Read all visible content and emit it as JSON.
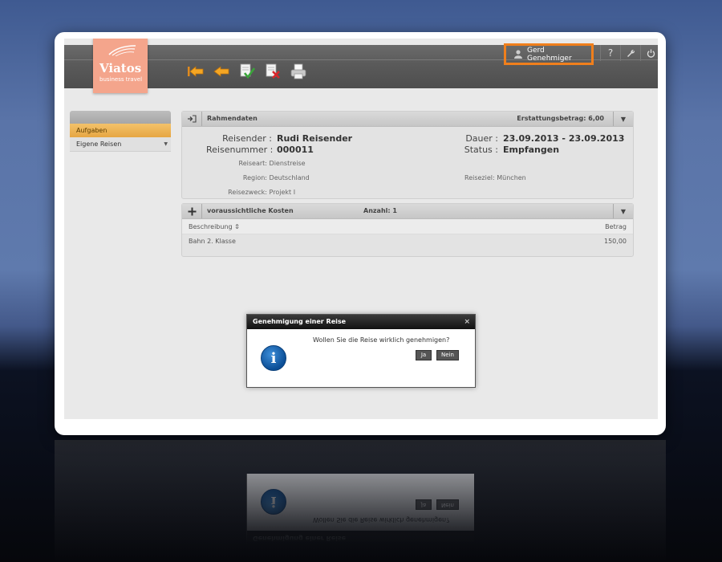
{
  "app": {
    "logo_name": "Viatos",
    "logo_tagline": "business travel",
    "user_name": "Gerd Genehmiger",
    "accent_color": "#f07f1c",
    "logo_color": "#f4a58c"
  },
  "toolbar": {
    "icons": [
      "back-first-icon",
      "back-icon",
      "approve-icon",
      "reject-icon",
      "print-icon"
    ]
  },
  "header_icons": [
    "help-icon",
    "wrench-icon",
    "power-icon"
  ],
  "help_glyph": "?",
  "sidebar": {
    "items": [
      {
        "label": "Aufgaben",
        "active": true
      },
      {
        "label": "Eigene Reisen",
        "active": false
      }
    ]
  },
  "rahmendaten": {
    "title": "Rahmendaten",
    "erstattung_label": "Erstattungsbetrag: 6,00",
    "reisender_label": "Reisender :",
    "reisender_value": "Rudi Reisender",
    "reisenummer_label": "Reisenummer :",
    "reisenummer_value": "000011",
    "dauer_label": "Dauer :",
    "dauer_value": "23.09.2013 - 23.09.2013",
    "status_label": "Status :",
    "status_value": "Empfangen",
    "reiseart_label": "Reiseart:",
    "reiseart_value": "Dienstreise",
    "region_label": "Region:",
    "region_value": "Deutschland",
    "reiseziel_label": "Reiseziel:",
    "reiseziel_value": "München",
    "reisezweck_label": "Reisezweck:",
    "reisezweck_value": "Projekt I"
  },
  "kosten": {
    "title": "voraussichtliche Kosten",
    "anzahl_label": "Anzahl: 1",
    "col_beschreibung": "Beschreibung",
    "col_betrag": "Betrag",
    "rows": [
      {
        "beschreibung": "Bahn 2. Klasse",
        "betrag": "150,00"
      }
    ]
  },
  "dialog": {
    "title": "Genehmigung einer Reise",
    "message": "Wollen Sie die Reise wirklich genehmigen?",
    "yes_label": "Ja",
    "no_label": "Nein",
    "close_glyph": "×",
    "info_glyph": "i"
  }
}
